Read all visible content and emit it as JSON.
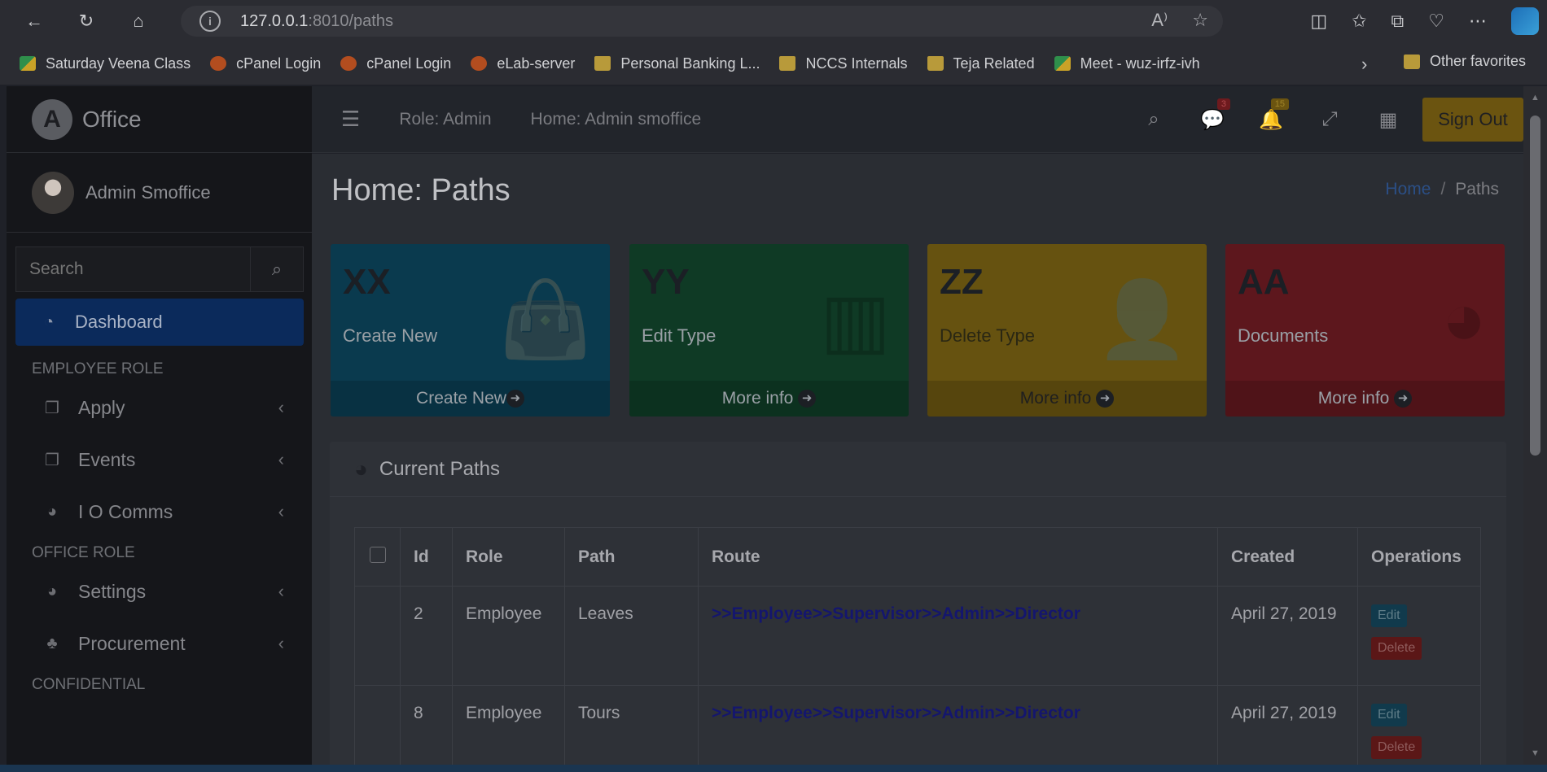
{
  "browser": {
    "url_host": "127.0.0.1",
    "url_rest": ":8010/paths",
    "bookmarks": [
      {
        "label": "Saturday Veena Class",
        "icon": "meet"
      },
      {
        "label": "cPanel Login",
        "icon": "cpanel"
      },
      {
        "label": "cPanel Login",
        "icon": "cpanel"
      },
      {
        "label": "eLab-server",
        "icon": "cpanel"
      },
      {
        "label": "Personal Banking L...",
        "icon": "folder"
      },
      {
        "label": "NCCS Internals",
        "icon": "folder"
      },
      {
        "label": "Teja Related",
        "icon": "folder"
      },
      {
        "label": "Meet - wuz-irfz-ivh",
        "icon": "meet"
      }
    ],
    "other_favorites": "Other favorites"
  },
  "sidebar": {
    "brand": "Office",
    "brand_logo_letter": "A",
    "user": "Admin Smoffice",
    "search_placeholder": "Search",
    "active_item": "Dashboard",
    "sections": {
      "employee": "EMPLOYEE ROLE",
      "office": "OFFICE ROLE",
      "confidential": "CONFIDENTIAL"
    },
    "employee_items": [
      "Apply",
      "Events",
      "I O Comms"
    ],
    "office_items": [
      "Settings",
      "Procurement"
    ]
  },
  "topbar": {
    "role": "Role: Admin",
    "home": "Home: Admin smoffice",
    "messages_badge": "3",
    "notifications_badge": "15",
    "sign_out": "Sign Out"
  },
  "content": {
    "title": "Home: Paths",
    "breadcrumb_home": "Home",
    "breadcrumb_current": "Paths",
    "boxes": [
      {
        "title": "XX",
        "subtitle": "Create New",
        "footer": "Create New",
        "color": "#0a3a4e",
        "icon": "shopping-bag-icon"
      },
      {
        "title": "YY",
        "subtitle": "Edit Type",
        "footer": "More info",
        "color": "#0f3a25",
        "icon": "bar-chart-icon"
      },
      {
        "title": "ZZ",
        "subtitle": "Delete Type",
        "footer": "More info",
        "color": "#665210",
        "icon": "add-user-icon"
      },
      {
        "title": "AA",
        "subtitle": "Documents",
        "footer": "More info",
        "color": "#5d171d",
        "icon": "pie-chart-icon"
      }
    ],
    "card_title": "Current Paths",
    "table": {
      "headers": [
        "Id",
        "Role",
        "Path",
        "Route",
        "Created",
        "Operations"
      ],
      "rows": [
        {
          "id": "2",
          "role": "Employee",
          "path": "Leaves",
          "route": ">>Employee>>Supervisor>>Admin>>Director",
          "created": "April 27, 2019"
        },
        {
          "id": "8",
          "role": "Employee",
          "path": "Tours",
          "route": ">>Employee>>Supervisor>>Admin>>Director",
          "created": "April 27, 2019"
        }
      ],
      "edit_label": "Edit",
      "delete_label": "Delete"
    }
  }
}
